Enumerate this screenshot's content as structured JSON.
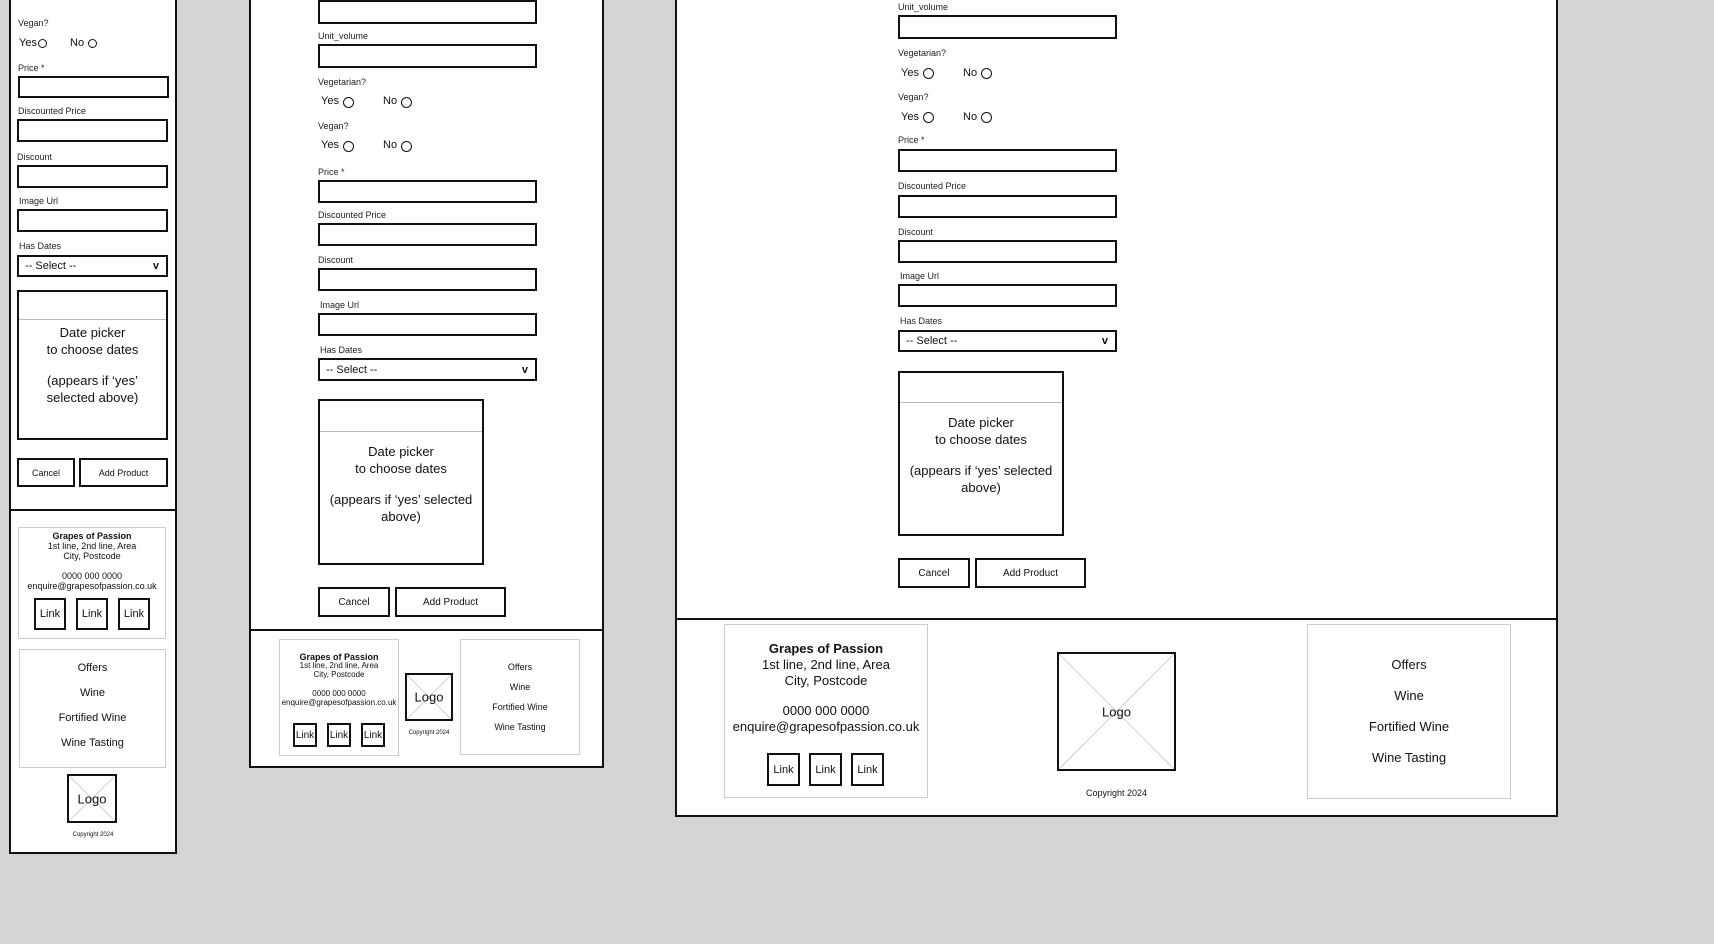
{
  "form": {
    "unit_volume": "Unit_volume",
    "vegetarian": "Vegetarian?",
    "vegan": "Vegan?",
    "yes": "Yes",
    "no": "No",
    "price": "Price *",
    "discounted_price": "Discounted Price",
    "discount": "Discount",
    "image_url": "Image Url",
    "has_dates": "Has Dates",
    "select_value": "-- Select --",
    "select_chevron": "v",
    "datepicker_line1": "Date picker",
    "datepicker_line2": "to choose dates",
    "datepicker_line3a": "(appears if ‘yes’",
    "datepicker_line3b": "selected above)",
    "datepicker_line3": "(appears if ‘yes’ selected",
    "datepicker_line4": "above)",
    "cancel": "Cancel",
    "add_product": "Add Product"
  },
  "footer": {
    "company": "Grapes of Passion",
    "address1": "1st line, 2nd line, Area",
    "address2": "City, Postcode",
    "phone": "0000 000 0000",
    "email": "enquire@grapesofpassion.co.uk",
    "link": "Link",
    "logo": "Logo",
    "copyright": "Copyright 2024",
    "nav": [
      "Offers",
      "Wine",
      "Fortified Wine",
      "Wine Tasting"
    ]
  },
  "icons": [
    "radio-circle-icon",
    "chevron-down-icon",
    "logo-placeholder-icon"
  ]
}
